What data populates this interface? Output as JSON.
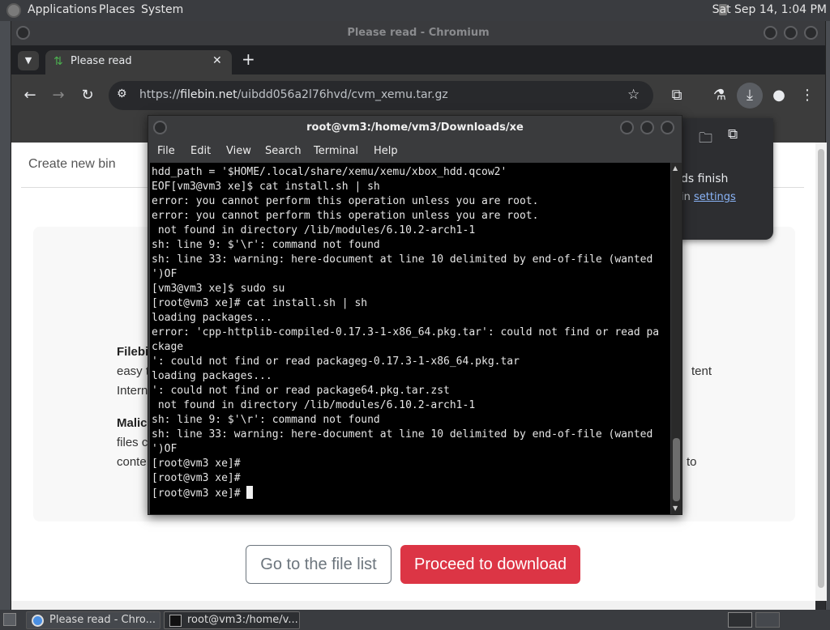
{
  "top_panel": {
    "menus": [
      "Applications",
      "Places",
      "System"
    ],
    "clock": "Sat Sep 14,  1:04 PM"
  },
  "browser": {
    "window_title": "Please read - Chromium",
    "tab_title": "Please read",
    "url_prefix": "https://",
    "url_domain": "filebin.net",
    "url_path": "/uibdd056a2l76hvd/cvm_xemu.tar.gz"
  },
  "download_popup": {
    "text_line1": "ds finish",
    "text_line2_prefix": "in ",
    "settings_link": "settings"
  },
  "page": {
    "create_bin": "Create new bin",
    "card_lines": [
      {
        "bold": "Filebi",
        "text": ""
      },
      {
        "bold": "",
        "text": "easy t"
      },
      {
        "bold": "",
        "text": "Intern"
      },
      {
        "bold": "Malic",
        "text": ""
      },
      {
        "bold": "",
        "text": "files c"
      },
      {
        "bold": "",
        "text": "conte"
      }
    ],
    "card_right": [
      "tent",
      "to"
    ],
    "btn_filelist": "Go to the file list",
    "btn_download": "Proceed to download"
  },
  "terminal": {
    "window_title": "root@vm3:/home/vm3/Downloads/xe",
    "menus": [
      "File",
      "Edit",
      "View",
      "Search",
      "Terminal",
      "Help"
    ],
    "lines": [
      "hdd_path = '$HOME/.local/share/xemu/xemu/xbox_hdd.qcow2'",
      "",
      "EOF[vm3@vm3 xe]$ cat install.sh | sh",
      "error: you cannot perform this operation unless you are root.",
      "error: you cannot perform this operation unless you are root.",
      " not found in directory /lib/modules/6.10.2-arch1-1",
      "sh: line 9: $'\\r': command not found",
      "sh: line 33: warning: here-document at line 10 delimited by end-of-file (wanted",
      "')OF",
      "[vm3@vm3 xe]$ sudo su",
      "[root@vm3 xe]# cat install.sh | sh",
      "loading packages...",
      "error: 'cpp-httplib-compiled-0.17.3-1-x86_64.pkg.tar': could not find or read pa",
      "ckage",
      "': could not find or read packageg-0.17.3-1-x86_64.pkg.tar",
      "loading packages...",
      "': could not find or read package64.pkg.tar.zst",
      " not found in directory /lib/modules/6.10.2-arch1-1",
      "sh: line 9: $'\\r': command not found",
      "sh: line 33: warning: here-document at line 10 delimited by end-of-file (wanted",
      "')OF",
      "[root@vm3 xe]#",
      "[root@vm3 xe]#"
    ],
    "prompt": "[root@vm3 xe]# "
  },
  "taskbar": {
    "tasks": [
      "Please read - Chro...",
      "root@vm3:/home/v..."
    ]
  }
}
